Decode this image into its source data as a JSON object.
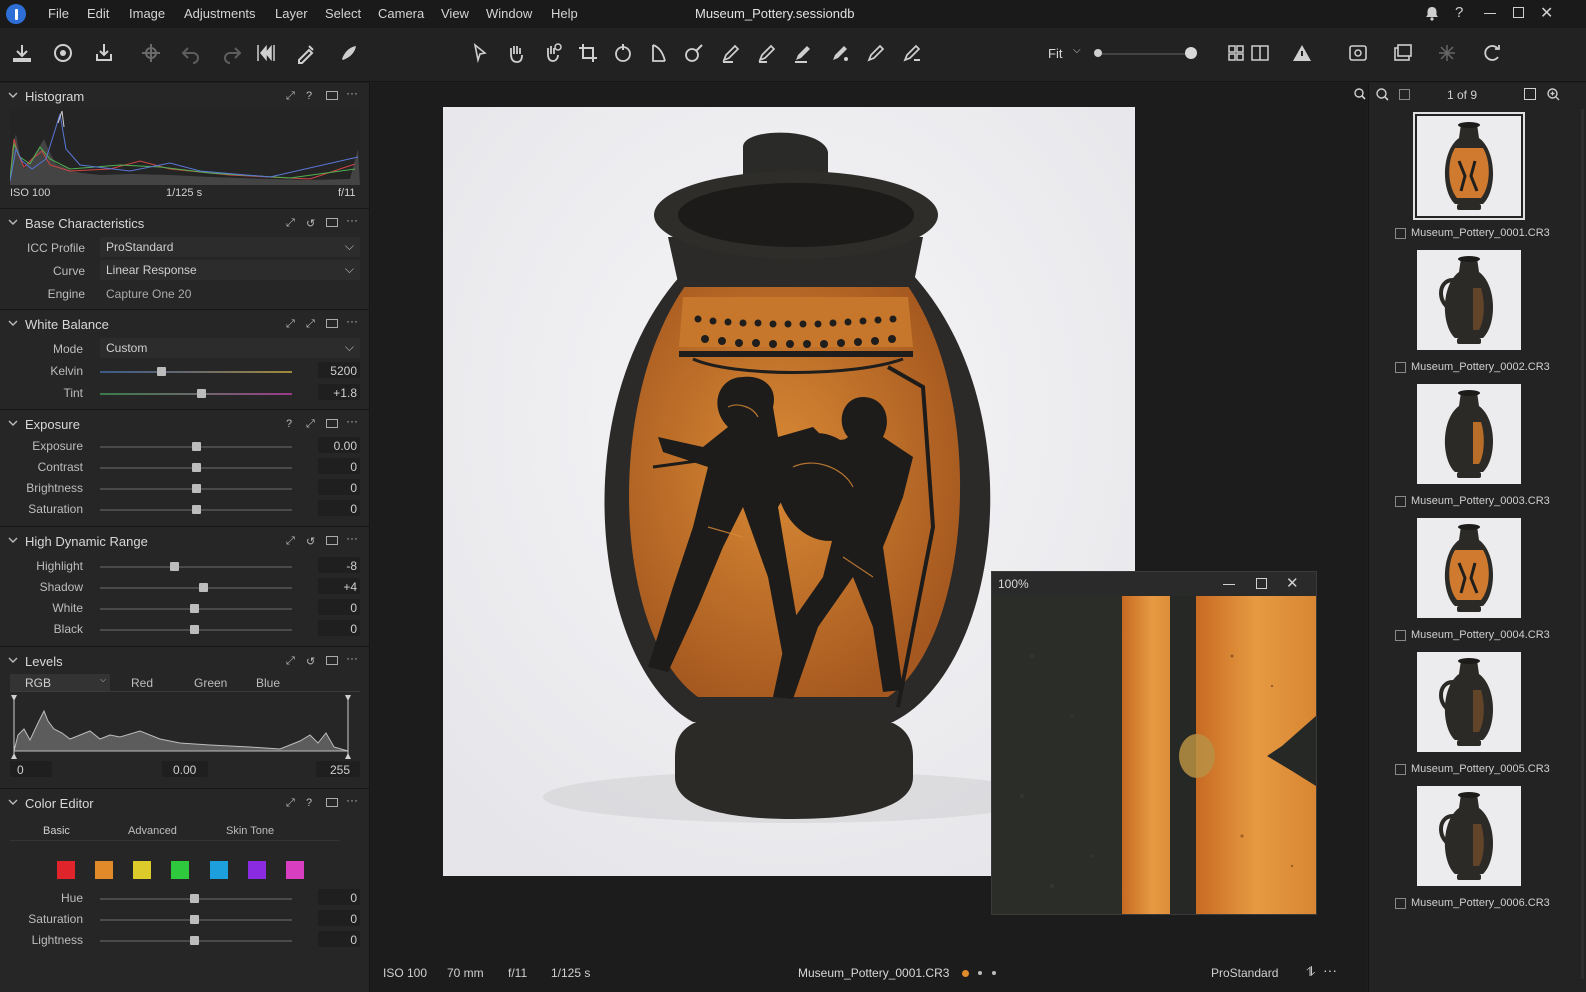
{
  "menubar": {
    "items": [
      "File",
      "Edit",
      "Image",
      "Adjustments",
      "Layer",
      "Select",
      "Camera",
      "View",
      "Window",
      "Help"
    ],
    "title": "Museum_Pottery.sessiondb"
  },
  "toolbar": {
    "zoom_label": "Fit"
  },
  "histogram": {
    "title": "Histogram",
    "iso": "ISO 100",
    "shutter": "1/125 s",
    "aperture": "f/11"
  },
  "base": {
    "title": "Base Characteristics",
    "icc_label": "ICC Profile",
    "icc_value": "ProStandard",
    "curve_label": "Curve",
    "curve_value": "Linear Response",
    "engine_label": "Engine",
    "engine_value": "Capture One 20"
  },
  "wb": {
    "title": "White Balance",
    "mode_label": "Mode",
    "mode_value": "Custom",
    "kelvin_label": "Kelvin",
    "kelvin_value": "5200",
    "kelvin_level": 0.32,
    "tint_label": "Tint",
    "tint_value": "+1.8",
    "tint_level": 0.53
  },
  "exposure": {
    "title": "Exposure",
    "rows": [
      {
        "label": "Exposure",
        "value": "0.00",
        "level": 0.5
      },
      {
        "label": "Contrast",
        "value": "0",
        "level": 0.5
      },
      {
        "label": "Brightness",
        "value": "0",
        "level": 0.5
      },
      {
        "label": "Saturation",
        "value": "0",
        "level": 0.5
      }
    ]
  },
  "hdr": {
    "title": "High Dynamic Range",
    "rows": [
      {
        "label": "Highlight",
        "value": "-8",
        "level": 0.39
      },
      {
        "label": "Shadow",
        "value": "+4",
        "level": 0.54
      },
      {
        "label": "White",
        "value": "0",
        "level": 0.49
      },
      {
        "label": "Black",
        "value": "0",
        "level": 0.49
      }
    ]
  },
  "levels": {
    "title": "Levels",
    "tabs": [
      "RGB",
      "Red",
      "Green",
      "Blue"
    ],
    "low": "0",
    "mid": "0.00",
    "high": "255"
  },
  "color_editor": {
    "title": "Color Editor",
    "tabs": [
      "Basic",
      "Advanced",
      "Skin Tone"
    ],
    "swatches": [
      "#e0242b",
      "#e08a2a",
      "#dccb2b",
      "#2fc93d",
      "#1e9fdd",
      "#8a2be2",
      "#d83fc0"
    ],
    "rows": [
      {
        "label": "Hue",
        "value": "0",
        "level": 0.49
      },
      {
        "label": "Saturation",
        "value": "0",
        "level": 0.49
      },
      {
        "label": "Lightness",
        "value": "0",
        "level": 0.49
      }
    ]
  },
  "loupe": {
    "zoom": "100%"
  },
  "statusbar": {
    "iso": "ISO 100",
    "focal": "70 mm",
    "aperture": "f/11",
    "shutter": "1/125 s",
    "filename": "Museum_Pottery_0001.CR3",
    "profile": "ProStandard"
  },
  "browser": {
    "counter": "1 of 9",
    "items": [
      "Museum_Pottery_0001.CR3",
      "Museum_Pottery_0002.CR3",
      "Museum_Pottery_0003.CR3",
      "Museum_Pottery_0004.CR3",
      "Museum_Pottery_0005.CR3",
      "Museum_Pottery_0006.CR3"
    ]
  }
}
